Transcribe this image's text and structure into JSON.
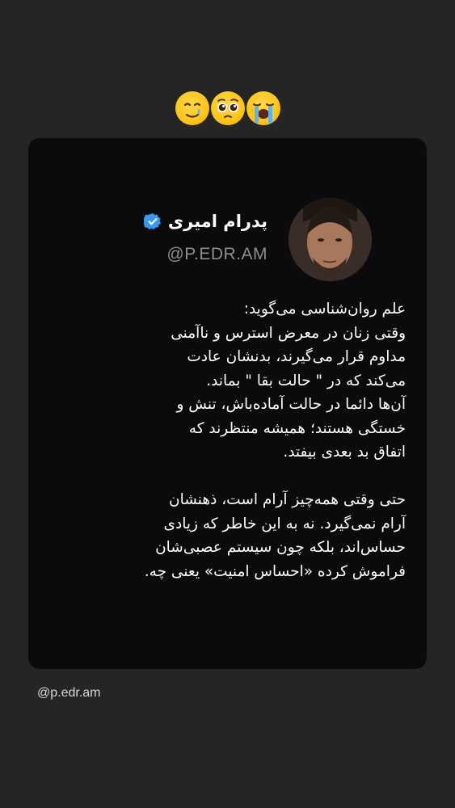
{
  "emojis": [
    "smiling-face-with-tear-icon",
    "pleading-face-icon",
    "loudly-crying-face-icon"
  ],
  "post": {
    "author_name": "پدرام امیری",
    "author_handle": "@P.EDR.AM",
    "paragraph_1": [
      "علم روان‌شناسی می‌گوید:",
      "وقتی زنان در معرض استرس و ناآمنی",
      "مداوم قرار می‌گیرند، بدنشان عادت",
      "می‌کند که در \" حالت  بقا \"  بماند.",
      "آن‌ها دائما در حالت آماده‌باش، تنش و",
      "خستگی هستند؛ همیشه منتظرند که",
      "اتفاق بد بعدی بیفتد."
    ],
    "paragraph_2": [
      "حتی وقتی همه‌چیز آرام است، ذهنشان",
      "آرام نمی‌گیرد. نه به این خاطر که زیادی",
      "حساس‌اند، بلکه چون سیستم عصبی‌شان",
      "فراموش کرده «احساس امنیت» یعنی چه."
    ]
  },
  "footer": {
    "handle": "@p.edr.am"
  },
  "colors": {
    "background": "#252525",
    "card": "#0b0b0d",
    "verified_badge": "#3a97f0",
    "handle_text": "#8e8e8e"
  }
}
